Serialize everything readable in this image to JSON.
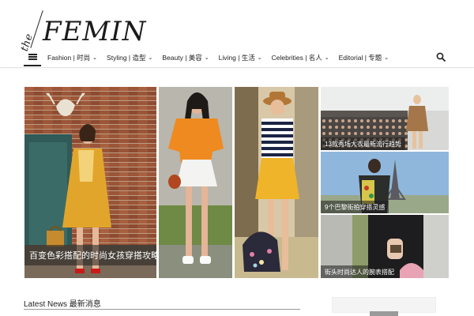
{
  "site": {
    "logo_prefix": "the",
    "logo_name": "FEMIN"
  },
  "nav": {
    "items": [
      {
        "label": "Fashion | 时尚"
      },
      {
        "label": "Styling | 造型"
      },
      {
        "label": "Beauty | 美容"
      },
      {
        "label": "Living | 生活"
      },
      {
        "label": "Celebrities | 名人"
      },
      {
        "label": "Editorial | 专题"
      }
    ]
  },
  "featured": {
    "main_caption": "百变色彩搭配的时尚女孩穿搭攻略",
    "tiles": [
      {
        "caption": "13款秀场大衣最新流行趋势"
      },
      {
        "caption": "9个巴黎街拍穿搭灵感"
      },
      {
        "caption": "街头时尚达人的腕表搭配"
      }
    ]
  },
  "section": {
    "latest_label": "Latest News 最新消息"
  },
  "colors": {
    "accent": "#222222",
    "caption_bg": "#1e1e1e"
  }
}
